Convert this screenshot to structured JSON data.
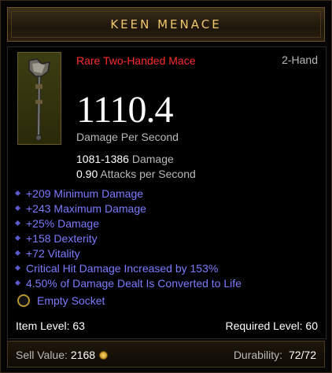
{
  "item": {
    "name": "KEEN MENACE",
    "type": "Rare Two-Handed Mace",
    "slot": "2-Hand",
    "dps": "1110.4",
    "dps_label": "Damage Per Second",
    "damage_range": "1081-1386",
    "damage_label": "Damage",
    "attack_speed": "0.90",
    "attack_speed_label": "Attacks per Second",
    "affixes": [
      "+209 Minimum Damage",
      "+243 Maximum Damage",
      "+25% Damage",
      "+158 Dexterity",
      "+72 Vitality",
      "Critical Hit Damage Increased by 153%",
      "4.50% of Damage Dealt Is Converted to Life"
    ],
    "socket": "Empty Socket",
    "item_level": "Item Level: 63",
    "required_level": "Required Level: 60"
  },
  "footer": {
    "sell_label": "Sell Value:",
    "sell_value": "2168",
    "durability_label": "Durability:",
    "durability_value": "72/72"
  },
  "colors": {
    "title": "#f2c76a",
    "rare": "#ff2a2a",
    "magic": "#7b7bff"
  },
  "icons": {
    "item": "mace-icon",
    "socket": "socket-icon",
    "gold": "gold-coin-icon"
  }
}
